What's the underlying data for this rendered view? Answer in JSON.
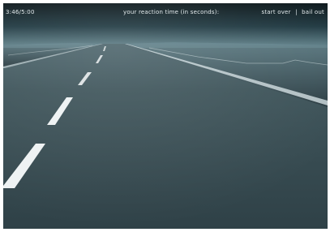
{
  "hud": {
    "timer": "3:46/5:00",
    "reaction_label": "your reaction time (in seconds):",
    "start_over_label": "start over",
    "separator": "|",
    "bail_out_label": "bail out"
  },
  "colors": {
    "sky_top": "#0e1a1e",
    "sky_horizon": "#5e7d86",
    "road_far": "#566e75",
    "road_near": "#34474d",
    "lane_marking": "#e8edee",
    "text": "#e4ecee"
  }
}
